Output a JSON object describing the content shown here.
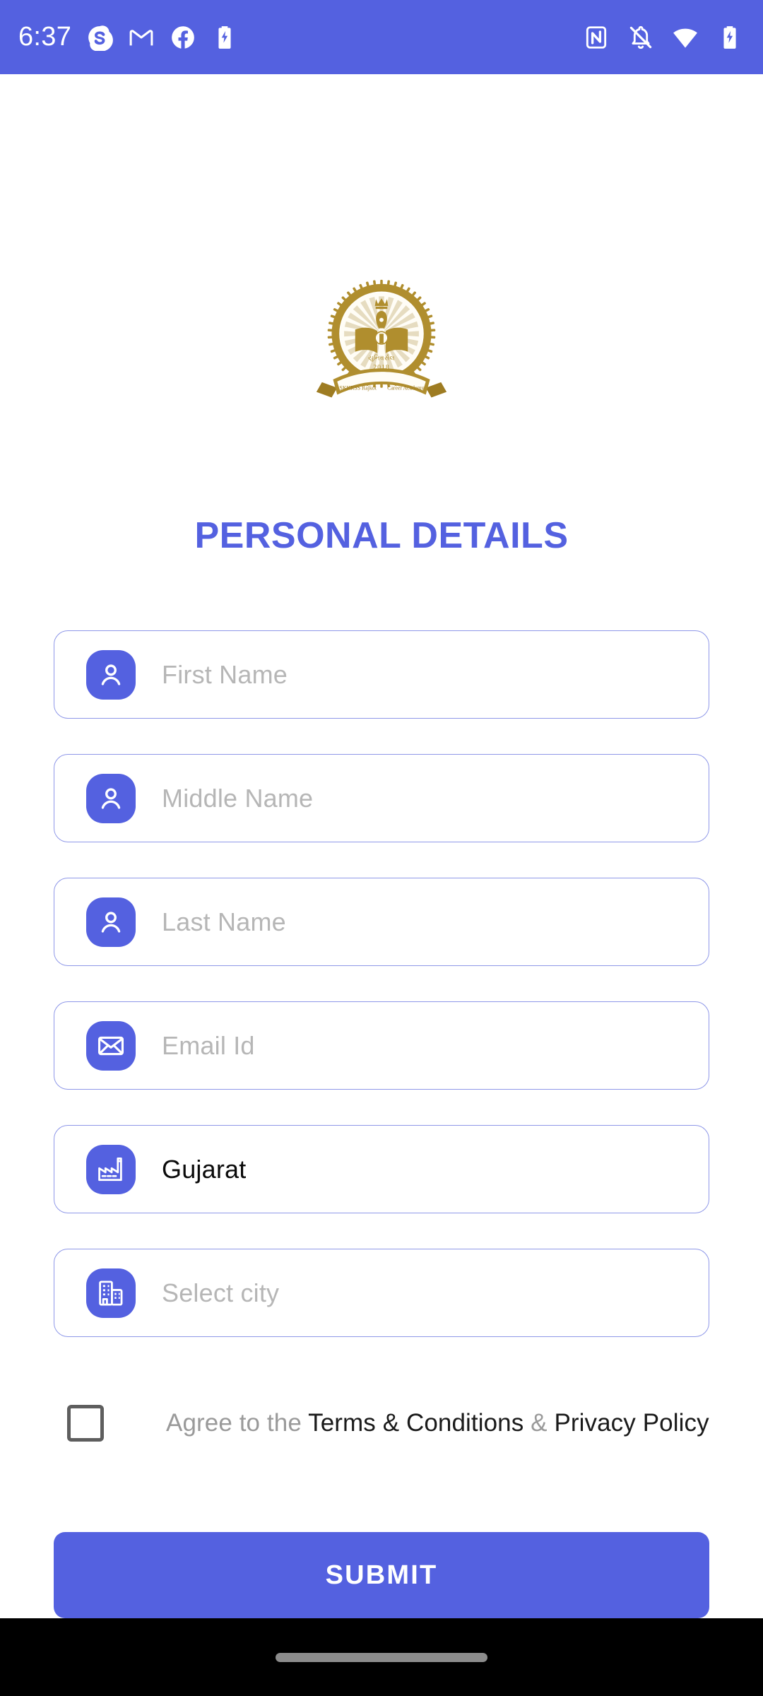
{
  "status_bar": {
    "clock": "6:37",
    "background_color": "#5461E0",
    "left_icons": [
      {
        "name": "skype-icon"
      },
      {
        "name": "gmail-icon"
      },
      {
        "name": "facebook-icon"
      },
      {
        "name": "battery-charging-icon"
      }
    ],
    "right_icons": [
      {
        "name": "nfc-icon"
      },
      {
        "name": "notifications-off-icon"
      },
      {
        "name": "wifi-icon"
      },
      {
        "name": "battery-charging-icon"
      }
    ]
  },
  "logo": {
    "name": "skkrss-academy-emblem",
    "ribbon_text_left": "SKKRSS Rajkot",
    "ribbon_text_right": "Career Academy",
    "year": "2018",
    "color": "#B08E2E"
  },
  "page": {
    "title": "PERSONAL DETAILS",
    "title_color": "#5461E0",
    "accent_color": "#5461E0",
    "border_color": "#8E97E8"
  },
  "form": {
    "fields": [
      {
        "name": "first-name",
        "icon": "person-icon",
        "text": "First Name",
        "filled": false
      },
      {
        "name": "middle-name",
        "icon": "person-icon",
        "text": "Middle Name",
        "filled": false
      },
      {
        "name": "last-name",
        "icon": "person-icon",
        "text": "Last Name",
        "filled": false
      },
      {
        "name": "email-id",
        "icon": "envelope-icon",
        "text": "Email Id",
        "filled": false
      },
      {
        "name": "state",
        "icon": "factory-icon",
        "text": "Gujarat",
        "filled": true
      },
      {
        "name": "city",
        "icon": "buildings-icon",
        "text": "Select city",
        "filled": false
      }
    ]
  },
  "terms": {
    "checked": false,
    "prefix": "Agree to the ",
    "terms_link": "Terms & Conditions",
    "separator": " & ",
    "privacy_link": "Privacy Policy"
  },
  "submit": {
    "label": "SUBMIT",
    "background_color": "#5461E0",
    "text_color": "#FFFFFF"
  },
  "nav_bar": {
    "name": "gesture-navigation-bar",
    "background_color": "#000000",
    "handle_color": "#8C8C8C"
  }
}
